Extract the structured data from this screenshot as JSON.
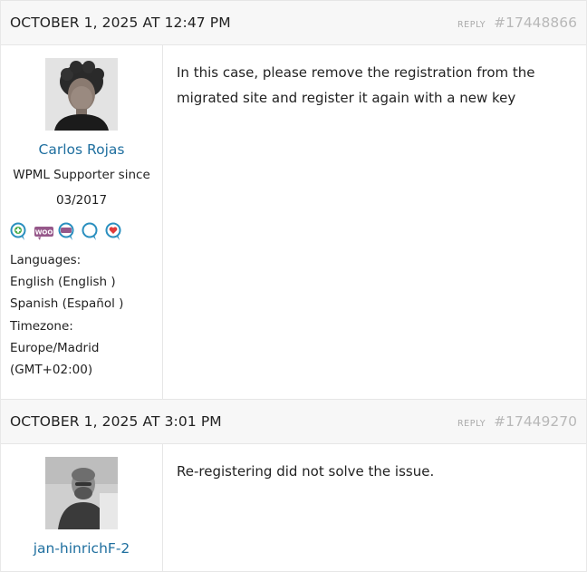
{
  "posts": [
    {
      "date": "OCTOBER 1, 2025 AT 12:47 PM",
      "reply_label": "Reply",
      "post_id": "#17448866",
      "author": "Carlos Rojas",
      "supporter_line1": "WPML Supporter since",
      "supporter_line2": "03/2017",
      "languages_label": "Languages:",
      "languages": [
        "English (English )",
        "Spanish (Español )"
      ],
      "timezone_label": "Timezone:",
      "timezone_line1": "Europe/Madrid",
      "timezone_line2": "(GMT+02:00)",
      "text": "In this case, please remove the registration from the migrated site and register it again with a new key"
    },
    {
      "date": "OCTOBER 1, 2025 AT 3:01 PM",
      "reply_label": "Reply",
      "post_id": "#17449270",
      "author": "jan-hinrichF-2",
      "text": "Re-registering did not solve the issue."
    }
  ],
  "badge_icons": [
    "plus-speech-icon",
    "woocommerce-icon",
    "woo-speech-icon",
    "speech-bubble-icon",
    "heart-speech-icon"
  ],
  "colors": {
    "author_link": "#1f6f9f",
    "header_bg": "#f7f7f7",
    "muted": "#b8b8b8"
  }
}
